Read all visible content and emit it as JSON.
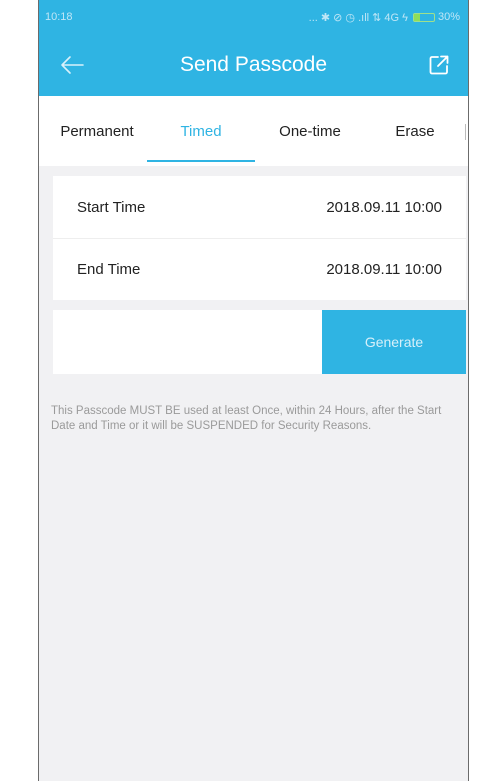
{
  "status_bar": {
    "time": "10:18",
    "icons_text": "... ✱ ⊘ ◷ .ıll ⇅ 4G ϟ",
    "battery_level": 0.3,
    "battery_text": "30%",
    "battery_color": "#8ede5a"
  },
  "app_bar": {
    "title": "Send Passcode",
    "back_icon": "back-arrow-icon",
    "share_icon": "share-external-icon",
    "background": "#2fb4e3"
  },
  "tabs": [
    {
      "label": "Permanent",
      "active": false
    },
    {
      "label": "Timed",
      "active": true
    },
    {
      "label": "One-time",
      "active": false
    },
    {
      "label": "Erase",
      "active": false
    }
  ],
  "time_settings": {
    "start_label": "Start Time",
    "start_value": "2018.09.11 10:00",
    "end_label": "End Time",
    "end_value": "2018.09.11 10:00"
  },
  "generate": {
    "input_value": "",
    "button_label": "Generate"
  },
  "notice": "This Passcode MUST BE used at least Once, within 24 Hours, after the Start Date and Time or it will be SUSPENDED for Security Reasons."
}
